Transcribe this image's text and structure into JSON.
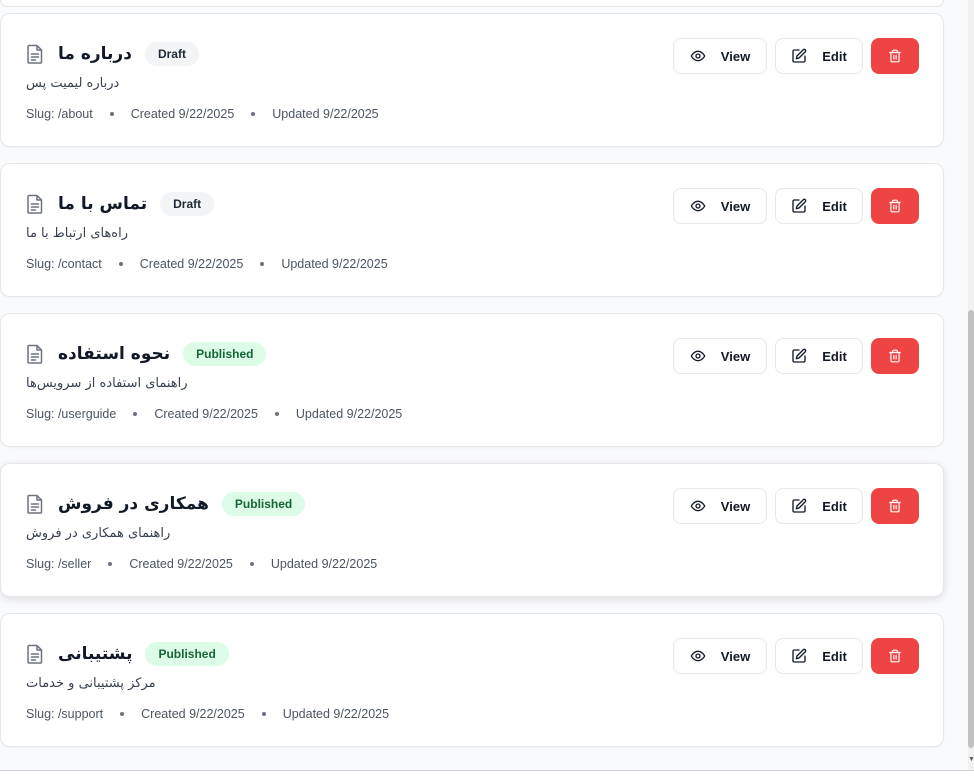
{
  "pages": [
    {
      "title": "درباره ما",
      "status": "Draft",
      "status_type": "draft",
      "description": "درباره لیمیت پس",
      "slug": "Slug: /about",
      "created": "Created 9/22/2025",
      "updated": "Updated 9/22/2025"
    },
    {
      "title": "تماس با ما",
      "status": "Draft",
      "status_type": "draft",
      "description": "راه‌های ارتباط با ما",
      "slug": "Slug: /contact",
      "created": "Created 9/22/2025",
      "updated": "Updated 9/22/2025"
    },
    {
      "title": "نحوه استفاده",
      "status": "Published",
      "status_type": "published",
      "description": "راهنمای استفاده از سرویس‌ها",
      "slug": "Slug: /userguide",
      "created": "Created 9/22/2025",
      "updated": "Updated 9/22/2025"
    },
    {
      "title": "همکاری در فروش",
      "status": "Published",
      "status_type": "published",
      "description": "راهنمای همکاری در فروش",
      "slug": "Slug: /seller",
      "created": "Created 9/22/2025",
      "updated": "Updated 9/22/2025"
    },
    {
      "title": "پشتیبانی",
      "status": "Published",
      "status_type": "published",
      "description": "مرکز پشتیبانی و خدمات",
      "slug": "Slug: /support",
      "created": "Created 9/22/2025",
      "updated": "Updated 9/22/2025"
    }
  ],
  "actions": {
    "view_label": "View",
    "edit_label": "Edit"
  },
  "icons": {
    "document": "document-icon",
    "view": "eye-icon",
    "edit": "edit-icon",
    "delete": "trash-icon"
  },
  "colors": {
    "draft_badge_bg": "#f3f4f6",
    "published_badge_bg": "#dcfce7",
    "published_badge_text": "#166534",
    "delete_button": "#ef4444"
  }
}
